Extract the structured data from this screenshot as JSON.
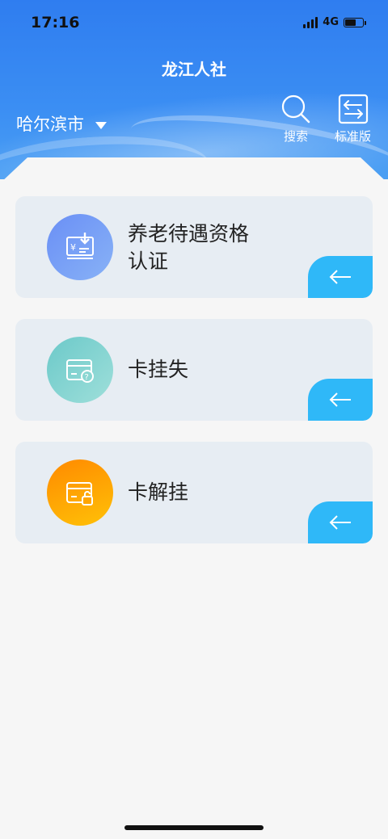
{
  "status": {
    "time": "17:16",
    "network": "4G"
  },
  "app": {
    "title": "龙江人社"
  },
  "city": {
    "name": "哈尔滨市"
  },
  "actions": {
    "search_label": "搜索",
    "version_label": "标准版"
  },
  "services": [
    {
      "label": "养老待遇资格认证",
      "icon": "pension-certificate-icon",
      "color_from": "#6a8ff5",
      "color_to": "#88b2f7"
    },
    {
      "label": "卡挂失",
      "icon": "card-report-loss-icon",
      "color_from": "#6cc9c9",
      "color_to": "#9edfda"
    },
    {
      "label": "卡解挂",
      "icon": "card-unlock-icon",
      "color_from": "#ff8a00",
      "color_to": "#ffc107"
    }
  ],
  "colors": {
    "header_blue": "#2f7df0",
    "card_bg": "#e7edf3",
    "go_tab": "#2fb8f8"
  }
}
